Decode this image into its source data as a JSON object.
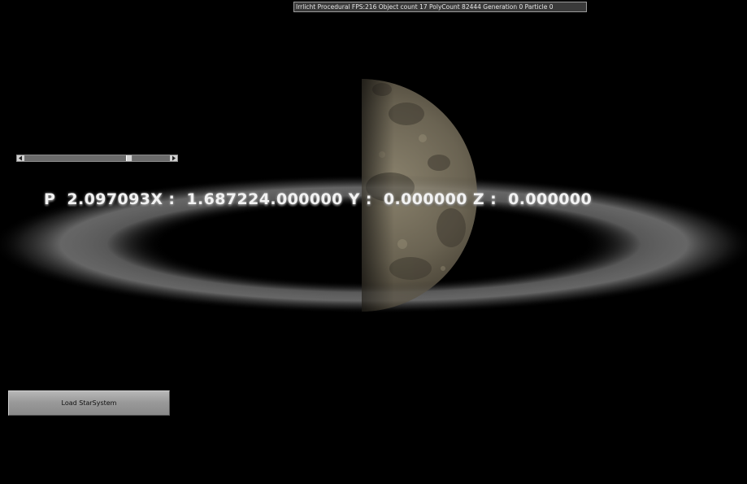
{
  "window": {
    "title": "Irrlicht Procedural FPS:216 Object count 17 PolyCount 82444 Generation 0 Particle 0"
  },
  "scrollbar": {
    "position_fraction": 0.73
  },
  "readout": {
    "text": "P  2.097093X :  1.687224.000000 Y :  0.000000 Z :  0.000000"
  },
  "buttons": {
    "load_label": "Load StarSystem"
  },
  "colors": {
    "background": "#000000",
    "planet": "#6e6755",
    "ring": "#b4b4b4"
  },
  "icons": {
    "left": "arrow-left-icon",
    "right": "arrow-right-icon"
  }
}
